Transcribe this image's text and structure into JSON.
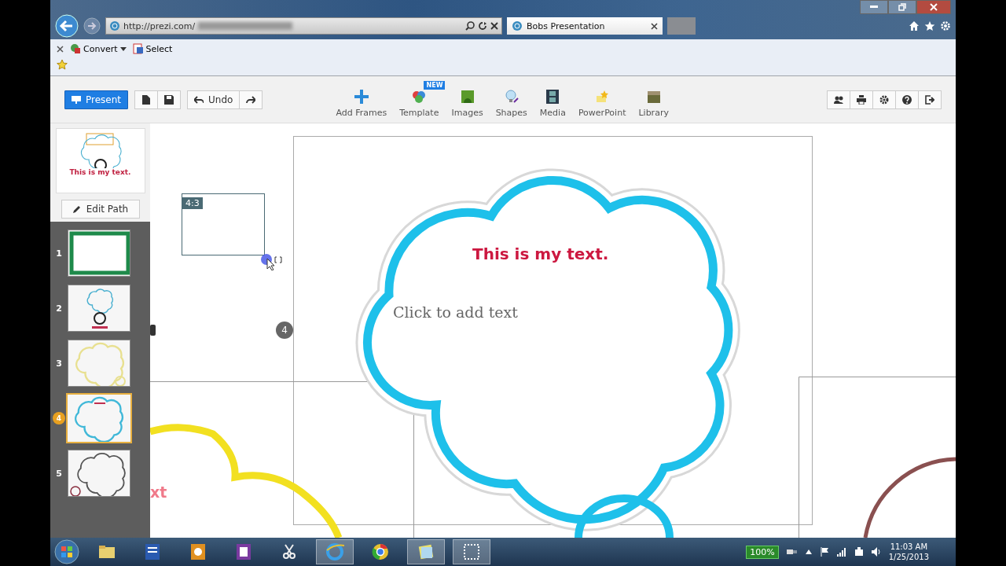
{
  "browser": {
    "url": "http://prezi.com/",
    "tabs": [
      {
        "label": "Bobs Presentation",
        "selected": true
      }
    ]
  },
  "command_bar": {
    "items": [
      {
        "label": "Convert",
        "kind": "dropdown"
      },
      {
        "label": "Select",
        "kind": "plain"
      }
    ]
  },
  "toolbar": {
    "present": "Present",
    "undo": "Undo",
    "tools": [
      {
        "label": "Add Frames",
        "kind": "frames"
      },
      {
        "label": "Template",
        "kind": "template",
        "badge": "NEW"
      },
      {
        "label": "Images",
        "kind": "images"
      },
      {
        "label": "Shapes",
        "kind": "shapes"
      },
      {
        "label": "Media",
        "kind": "media"
      },
      {
        "label": "PowerPoint",
        "kind": "powerpoint"
      },
      {
        "label": "Library",
        "kind": "library"
      }
    ]
  },
  "sidebar": {
    "overview_text": "This is my text.",
    "edit_path": "Edit Path",
    "slides": [
      {
        "number": "1",
        "selected": false,
        "kind": "frame"
      },
      {
        "number": "2",
        "selected": false,
        "kind": "overview"
      },
      {
        "number": "3",
        "selected": false,
        "kind": "yellow-cloud"
      },
      {
        "number": "4",
        "selected": true,
        "kind": "blue-cloud"
      },
      {
        "number": "5",
        "selected": false,
        "kind": "dark-cloud"
      }
    ]
  },
  "canvas": {
    "frame_label": "4:3",
    "step_badge": "4",
    "title": "This is my text.",
    "placeholder": "Click to add text",
    "partial_text": "xt"
  },
  "taskbar": {
    "battery": "100%",
    "time": "11:03 AM",
    "date": "1/25/2013"
  }
}
